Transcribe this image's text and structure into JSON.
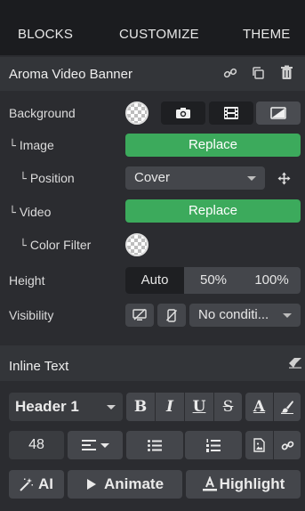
{
  "tabs": {
    "blocks": "BLOCKS",
    "customize": "CUSTOMIZE",
    "theme": "THEME"
  },
  "block": {
    "title": "Aroma Video Banner",
    "actions": [
      "link-icon",
      "duplicate-icon",
      "trash-icon"
    ]
  },
  "background": {
    "label": "Background",
    "types": [
      "camera-icon",
      "film-icon",
      "gradient-icon"
    ]
  },
  "image": {
    "label": "Image",
    "replace": "Replace"
  },
  "position": {
    "label": "Position",
    "value": "Cover"
  },
  "video": {
    "label": "Video",
    "replace": "Replace"
  },
  "color_filter": {
    "label": "Color Filter"
  },
  "height": {
    "label": "Height",
    "options": [
      "Auto",
      "50%",
      "100%"
    ],
    "selected": "Auto"
  },
  "visibility": {
    "label": "Visibility",
    "condition": "No conditi..."
  },
  "inline_text": {
    "title": "Inline Text",
    "style": "Header 1",
    "font_size": "48",
    "format": {
      "bold": "B",
      "italic": "I",
      "underline": "U",
      "strike": "S",
      "color": "A"
    },
    "ai": "AI",
    "animate": "Animate",
    "highlight": "Highlight"
  },
  "colors": {
    "accent": "#2f8fe0",
    "green": "#3caa5c"
  }
}
